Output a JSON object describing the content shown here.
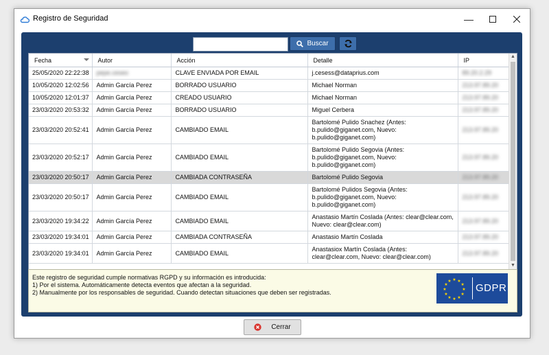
{
  "window": {
    "title": "Registro de Seguridad"
  },
  "toolbar": {
    "search_value": "",
    "buscar_label": "Buscar"
  },
  "table": {
    "columns": [
      "Fecha",
      "Autor",
      "Acción",
      "Detalle",
      "IP"
    ],
    "rows": [
      {
        "fecha": "25/05/2020 22:22:38",
        "autor": "pepe.ceseo",
        "accion": "CLAVE ENVIADA POR EMAIL",
        "detalle_lines": [
          "j.cesess@dataprius.com"
        ],
        "ip": "89.20.2.29"
      },
      {
        "fecha": "10/05/2020 12:02:56",
        "autor": "Admin García Perez",
        "accion": "BORRADO USUARIO",
        "detalle_lines": [
          "Michael Norman"
        ],
        "ip": "213.97.89.20"
      },
      {
        "fecha": "10/05/2020 12:01:37",
        "autor": "Admin García Perez",
        "accion": "CREADO USUARIO",
        "detalle_lines": [
          "Michael Norman"
        ],
        "ip": "213.97.89.20"
      },
      {
        "fecha": "23/03/2020 20:53:32",
        "autor": "Admin García Perez",
        "accion": "BORRADO USUARIO",
        "detalle_lines": [
          "Miguel Cerbera"
        ],
        "ip": "213.97.89.20"
      },
      {
        "fecha": "23/03/2020 20:52:41",
        "autor": "Admin García Perez",
        "accion": "CAMBIADO EMAIL",
        "detalle_lines": [
          "Bartolomé Pulido Snachez (Antes:",
          "b.pulido@giganet.com, Nuevo:",
          "b.pulido@giganet.com)"
        ],
        "ip": "213.97.89.20"
      },
      {
        "fecha": "23/03/2020 20:52:17",
        "autor": "Admin García Perez",
        "accion": "CAMBIADO EMAIL",
        "detalle_lines": [
          "Bartolomé Pulido Segovia (Antes:",
          "b.pulido@giganet.com, Nuevo:",
          "b.pulido@giganet.com)"
        ],
        "ip": "213.97.89.20"
      },
      {
        "fecha": "23/03/2020 20:50:17",
        "autor": "Admin García Perez",
        "accion": "CAMBIADA CONTRASEÑA",
        "detalle_lines": [
          "Bartolomé Pulido Segovia"
        ],
        "ip": "213.97.89.20",
        "selected": true
      },
      {
        "fecha": "23/03/2020 20:50:17",
        "autor": "Admin García Perez",
        "accion": "CAMBIADO EMAIL",
        "detalle_lines": [
          "Bartolomé Pulidos Segovia (Antes:",
          "b.pulido@giganet.com, Nuevo:",
          "b.pulido@giganet.com)"
        ],
        "ip": "213.97.89.20"
      },
      {
        "fecha": "23/03/2020 19:34:22",
        "autor": "Admin García Perez",
        "accion": "CAMBIADO EMAIL",
        "detalle_lines": [
          "Anastasio Martín Coslada (Antes: clear@clear.com,",
          "Nuevo: clear@clear.com)"
        ],
        "ip": "213.97.89.20"
      },
      {
        "fecha": "23/03/2020 19:34:01",
        "autor": "Admin García Perez",
        "accion": "CAMBIADA CONTRASEÑA",
        "detalle_lines": [
          "Anastasio Martín Coslada"
        ],
        "ip": "213.97.89.20"
      },
      {
        "fecha": "23/03/2020 19:34:01",
        "autor": "Admin García Perez",
        "accion": "CAMBIADO EMAIL",
        "detalle_lines": [
          "Anastasiox Martín Coslada (Antes:",
          "clear@clear.com, Nuevo: clear@clear.com)"
        ],
        "ip": "213.97.89.20"
      }
    ]
  },
  "info": {
    "lines": [
      "Este registro de seguridad cumple normativas RGPD y su información es introducida:",
      "1) Por el sistema. Automáticamente detecta eventos que afectan a la seguridad.",
      "2) Manualmente por los responsables de seguridad. Cuando detectan situaciones que deben ser registradas."
    ],
    "badge": "GDPR"
  },
  "footer": {
    "close_label": "Cerrar"
  },
  "colors": {
    "panel": "#1c3f6e",
    "button": "#3d6eab",
    "gdpr": "#1d4b9b",
    "info_bg": "#fbfbe6",
    "selected_row": "#d9d9d9"
  },
  "icons": [
    "cloud-icon",
    "minimize-icon",
    "maximize-icon",
    "close-icon",
    "search-icon",
    "refresh-icon",
    "sort-desc-icon",
    "eu-stars-icon",
    "close-circle-icon"
  ]
}
